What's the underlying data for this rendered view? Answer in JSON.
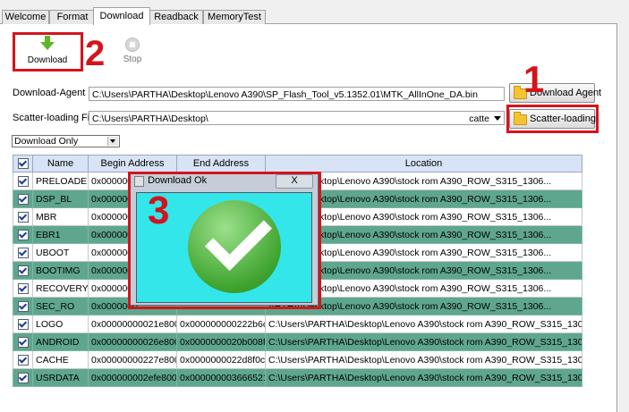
{
  "tabs": [
    "Welcome",
    "Format",
    "Download",
    "Readback",
    "MemoryTest"
  ],
  "active_tab": "Download",
  "toolbar": {
    "download_label": "Download",
    "stop_label": "Stop"
  },
  "annotations": {
    "n1": "1",
    "n2": "2",
    "n3": "3"
  },
  "download_agent": {
    "label": "Download-Agent",
    "value": "C:\\Users\\PARTHA\\Desktop\\Lenovo A390\\SP_Flash_Tool_v5.1352.01\\MTK_AllInOne_DA.bin",
    "button": "Download Agent"
  },
  "scatter": {
    "label": "Scatter-loading File",
    "value": "C:\\Users\\PARTHA\\Desktop\\",
    "suffix": "catte",
    "button": "Scatter-loading"
  },
  "mode": {
    "selected": "Download Only"
  },
  "table": {
    "headers": [
      "Name",
      "Begin Address",
      "End Address",
      "Location"
    ],
    "rows": [
      {
        "name": "PRELOADER",
        "begin": "0x0000000",
        "end": "",
        "loc": "ARTHA\\Desktop\\Lenovo A390\\stock rom A390_ROW_S315_1306..."
      },
      {
        "name": "DSP_BL",
        "begin": "0x0000000",
        "end": "",
        "loc": "ARTHA\\Desktop\\Lenovo A390\\stock rom A390_ROW_S315_1306..."
      },
      {
        "name": "MBR",
        "begin": "0x0000000",
        "end": "",
        "loc": "ARTHA\\Desktop\\Lenovo A390\\stock rom A390_ROW_S315_1306..."
      },
      {
        "name": "EBR1",
        "begin": "0x0000000",
        "end": "",
        "loc": "ARTHA\\Desktop\\Lenovo A390\\stock rom A390_ROW_S315_1306..."
      },
      {
        "name": "UBOOT",
        "begin": "0x0000000",
        "end": "",
        "loc": "ARTHA\\Desktop\\Lenovo A390\\stock rom A390_ROW_S315_1306..."
      },
      {
        "name": "BOOTIMG",
        "begin": "0x0000000",
        "end": "",
        "loc": "ARTHA\\Desktop\\Lenovo A390\\stock rom A390_ROW_S315_1306..."
      },
      {
        "name": "RECOVERY",
        "begin": "0x0000000",
        "end": "",
        "loc": "ARTHA\\Desktop\\Lenovo A390\\stock rom A390_ROW_S315_1306..."
      },
      {
        "name": "SEC_RO",
        "begin": "0x0000000",
        "end": "",
        "loc": "ARTHA\\Desktop\\Lenovo A390\\stock rom A390_ROW_S315_1306..."
      },
      {
        "name": "LOGO",
        "begin": "0x00000000021e8000",
        "end": "0x000000000222b6c1",
        "loc": "C:\\Users\\PARTHA\\Desktop\\Lenovo A390\\stock rom A390_ROW_S315_1306..."
      },
      {
        "name": "ANDROID",
        "begin": "0x00000000026e8000",
        "end": "0x0000000020b008f7",
        "loc": "C:\\Users\\PARTHA\\Desktop\\Lenovo A390\\stock rom A390_ROW_S315_1306..."
      },
      {
        "name": "CACHE",
        "begin": "0x00000000227e8000",
        "end": "0x0000000022d8f0c3",
        "loc": "C:\\Users\\PARTHA\\Desktop\\Lenovo A390\\stock rom A390_ROW_S315_1306..."
      },
      {
        "name": "USRDATA",
        "begin": "0x000000002efe8000",
        "end": "0x0000000036665213",
        "loc": "C:\\Users\\PARTHA\\Desktop\\Lenovo A390\\stock rom A390_ROW_S315_1306..."
      }
    ]
  },
  "dialog": {
    "title": "Download Ok",
    "close": "X"
  },
  "colors": {
    "row_alt": "#5fa68e",
    "highlight": "#d4141c",
    "dialog_body": "#33e6ea",
    "ok_green": "#3fa32e"
  }
}
